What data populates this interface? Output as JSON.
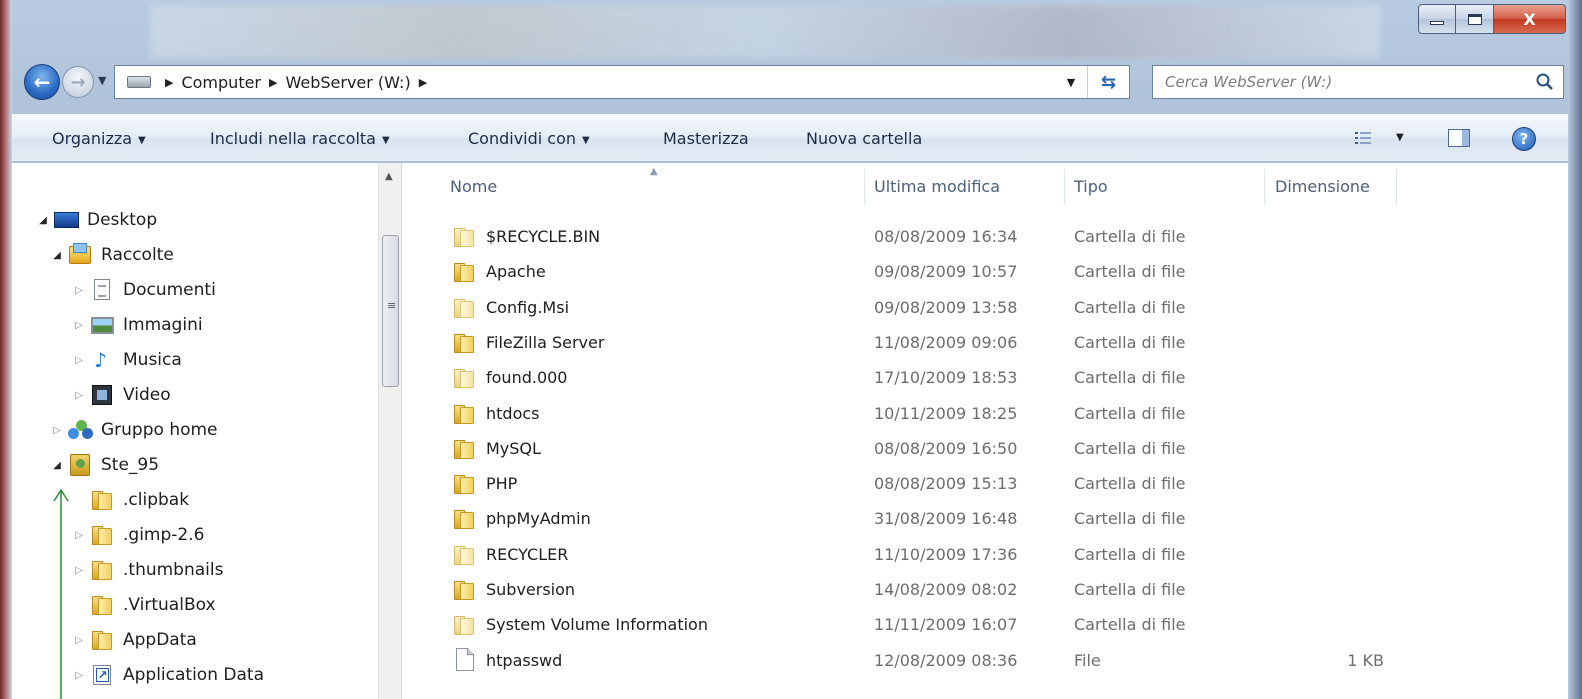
{
  "window": {
    "minimize_icon": "minimize-icon",
    "maximize_icon": "maximize-icon",
    "close_label": "X"
  },
  "nav": {
    "back_icon": "back-arrow-icon",
    "forward_icon": "forward-arrow-icon",
    "breadcrumbs": [
      "Computer",
      "WebServer (W:)"
    ],
    "search_placeholder": "Cerca WebServer (W:)"
  },
  "toolbar": {
    "organize": "Organizza",
    "include_in_library": "Includi nella raccolta",
    "share_with": "Condividi con",
    "burn": "Masterizza",
    "new_folder": "Nuova cartella"
  },
  "tree": [
    {
      "label": "Desktop",
      "icon": "desktop-icon",
      "state": "expanded"
    },
    {
      "label": "Raccolte",
      "icon": "libraries-icon",
      "state": "expanded"
    },
    {
      "label": "Documenti",
      "icon": "documents-icon",
      "state": "collapsed"
    },
    {
      "label": "Immagini",
      "icon": "pictures-icon",
      "state": "collapsed"
    },
    {
      "label": "Musica",
      "icon": "music-icon",
      "state": "collapsed"
    },
    {
      "label": "Video",
      "icon": "video-icon",
      "state": "collapsed"
    },
    {
      "label": "Gruppo home",
      "icon": "homegroup-icon",
      "state": "collapsed"
    },
    {
      "label": "Ste_95",
      "icon": "user-folder-icon",
      "state": "expanded"
    },
    {
      "label": ".clipbak",
      "icon": "folder-icon",
      "state": "none"
    },
    {
      "label": ".gimp-2.6",
      "icon": "folder-icon",
      "state": "collapsed"
    },
    {
      "label": ".thumbnails",
      "icon": "folder-icon",
      "state": "collapsed"
    },
    {
      "label": ".VirtualBox",
      "icon": "folder-icon",
      "state": "none"
    },
    {
      "label": "AppData",
      "icon": "folder-icon",
      "state": "collapsed"
    },
    {
      "label": "Application Data",
      "icon": "shortcut-folder-icon",
      "state": "collapsed"
    }
  ],
  "columns": {
    "name": "Nome",
    "modified": "Ultima modifica",
    "type": "Tipo",
    "size": "Dimensione"
  },
  "files": [
    {
      "name": "$RECYCLE.BIN",
      "modified": "08/08/2009 16:34",
      "type": "Cartella di file",
      "size": "",
      "icon": "folder-icon",
      "hidden": true
    },
    {
      "name": "Apache",
      "modified": "09/08/2009 10:57",
      "type": "Cartella di file",
      "size": "",
      "icon": "folder-icon",
      "hidden": false
    },
    {
      "name": "Config.Msi",
      "modified": "09/08/2009 13:58",
      "type": "Cartella di file",
      "size": "",
      "icon": "folder-icon",
      "hidden": true
    },
    {
      "name": "FileZilla Server",
      "modified": "11/08/2009 09:06",
      "type": "Cartella di file",
      "size": "",
      "icon": "folder-icon",
      "hidden": false
    },
    {
      "name": "found.000",
      "modified": "17/10/2009 18:53",
      "type": "Cartella di file",
      "size": "",
      "icon": "folder-icon",
      "hidden": true
    },
    {
      "name": "htdocs",
      "modified": "10/11/2009 18:25",
      "type": "Cartella di file",
      "size": "",
      "icon": "folder-icon",
      "hidden": false
    },
    {
      "name": "MySQL",
      "modified": "08/08/2009 16:50",
      "type": "Cartella di file",
      "size": "",
      "icon": "folder-icon",
      "hidden": false
    },
    {
      "name": "PHP",
      "modified": "08/08/2009 15:13",
      "type": "Cartella di file",
      "size": "",
      "icon": "folder-icon",
      "hidden": false
    },
    {
      "name": "phpMyAdmin",
      "modified": "31/08/2009 16:48",
      "type": "Cartella di file",
      "size": "",
      "icon": "folder-icon",
      "hidden": false
    },
    {
      "name": "RECYCLER",
      "modified": "11/10/2009 17:36",
      "type": "Cartella di file",
      "size": "",
      "icon": "folder-icon",
      "hidden": true
    },
    {
      "name": "Subversion",
      "modified": "14/08/2009 08:02",
      "type": "Cartella di file",
      "size": "",
      "icon": "folder-icon",
      "hidden": false
    },
    {
      "name": "System Volume Information",
      "modified": "11/11/2009 16:07",
      "type": "Cartella di file",
      "size": "",
      "icon": "folder-icon",
      "hidden": true
    },
    {
      "name": "htpasswd",
      "modified": "12/08/2009 08:36",
      "type": "File",
      "size": "1 KB",
      "icon": "file-icon",
      "hidden": false
    }
  ],
  "colors": {
    "accent": "#2a6ac3",
    "toolbar_text": "#1e2d44",
    "column_header_text": "#4c607a",
    "secondary_text": "#6d6d6d"
  }
}
